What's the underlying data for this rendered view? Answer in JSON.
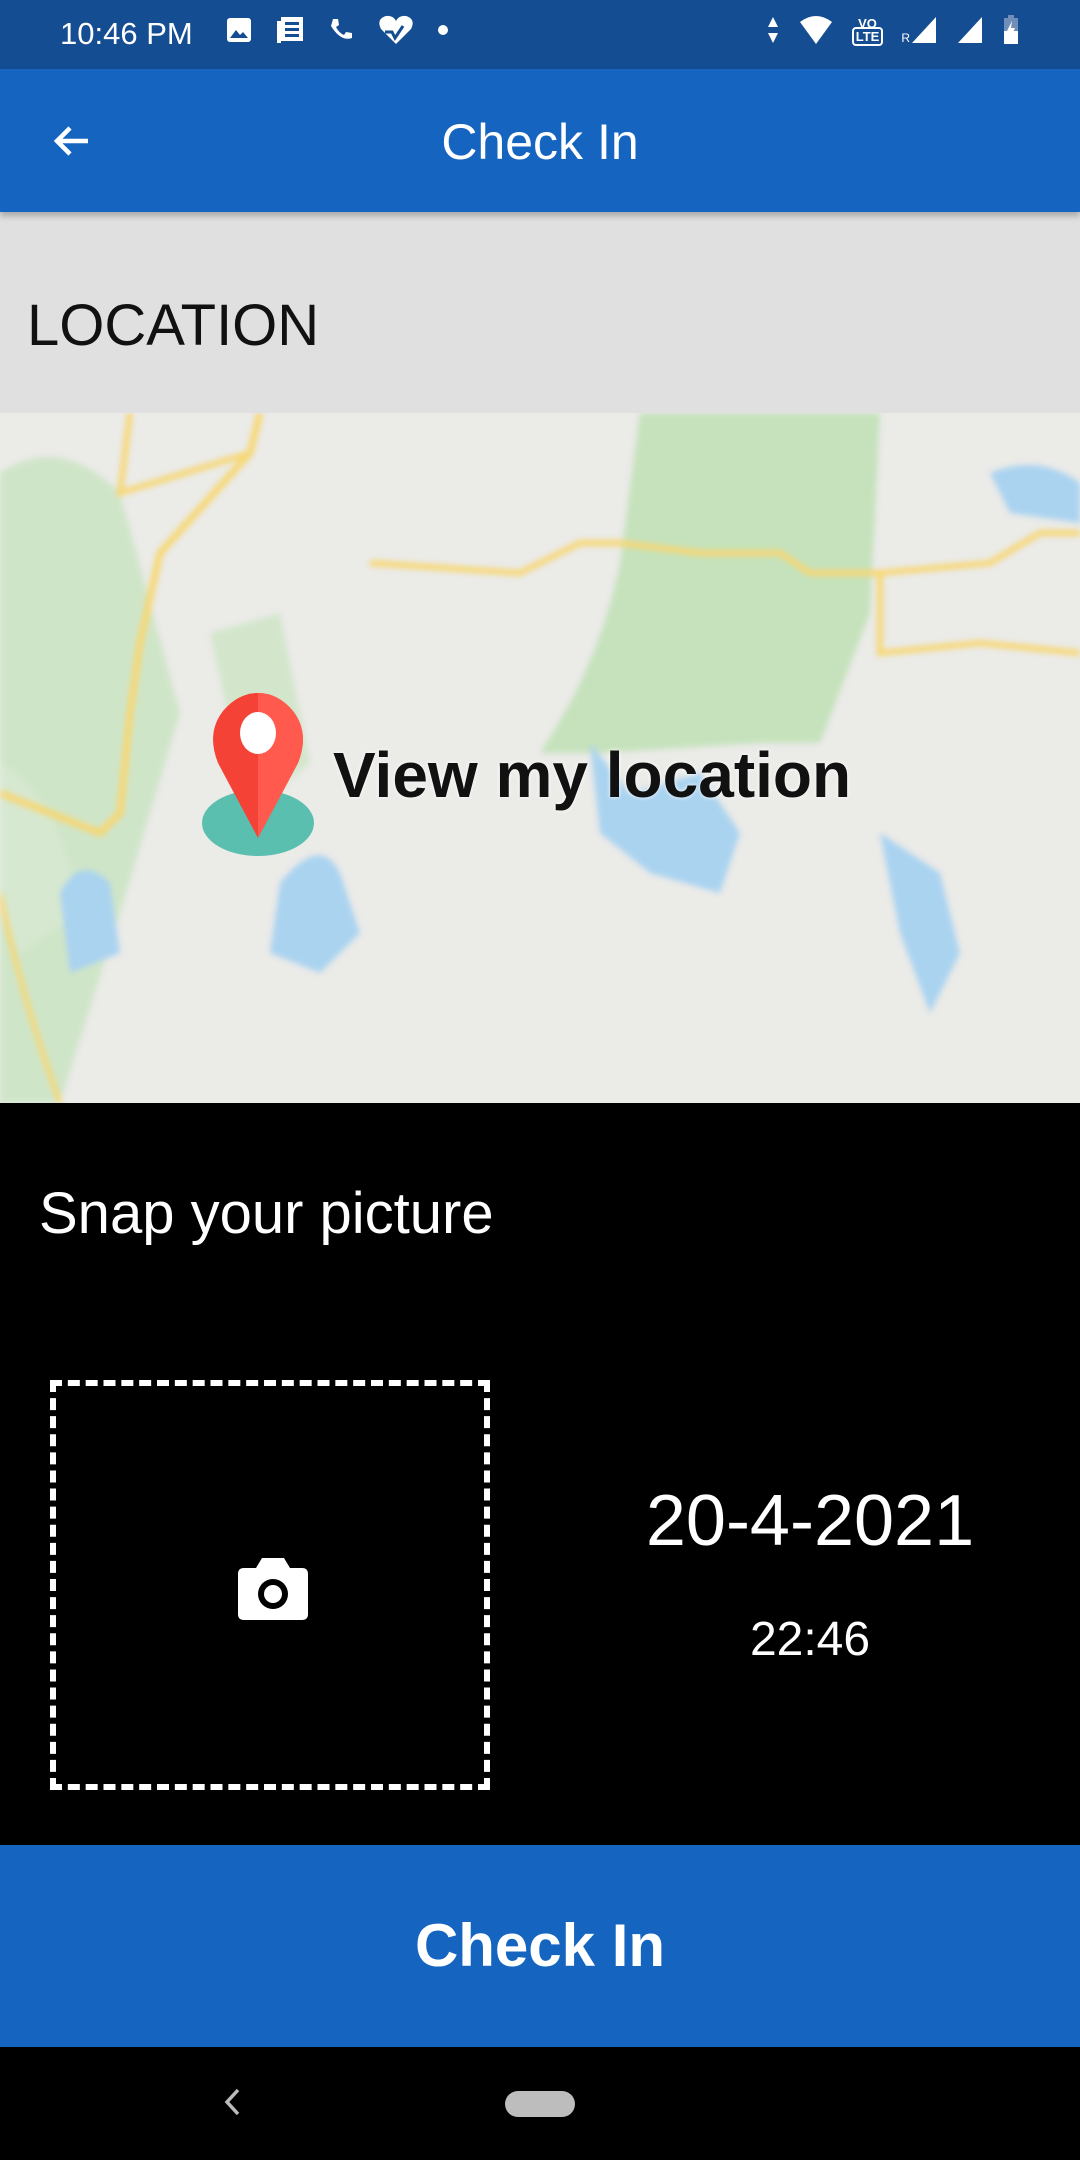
{
  "status_bar": {
    "time": "10:46 PM",
    "left_icons": [
      "image-icon",
      "news-icon",
      "phone-icon",
      "health-icon",
      "dot-icon"
    ],
    "right_icons": [
      "data-arrows-icon",
      "wifi-icon",
      "volte-icon",
      "signal-roaming-icon",
      "signal-icon",
      "battery-charging-icon"
    ],
    "volte_label": "VO",
    "lte_label": "LTE",
    "roaming_label": "R"
  },
  "app_bar": {
    "title": "Check In",
    "back_icon": "arrow-left-icon"
  },
  "location": {
    "header": "LOCATION",
    "view_label": "View my location",
    "pin_icon": "map-pin-icon"
  },
  "snap": {
    "title": "Snap your picture",
    "camera_icon": "camera-icon"
  },
  "datetime": {
    "date": "20-4-2021",
    "time": "22:46"
  },
  "check_in_button": "Check In",
  "colors": {
    "primary": "#1565c0",
    "status_bar": "#144d92",
    "pin_red": "#f44336",
    "pin_base": "#5bbfb0"
  }
}
